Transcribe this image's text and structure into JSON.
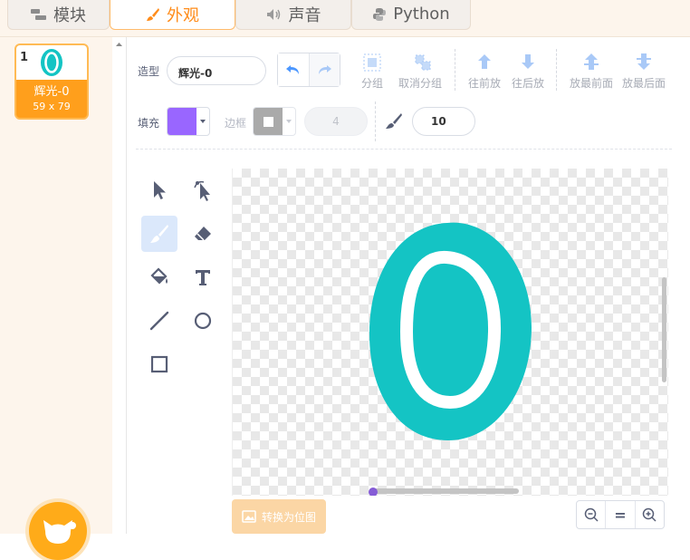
{
  "tabs": [
    {
      "label": "模块",
      "icon": "blocks-icon"
    },
    {
      "label": "外观",
      "icon": "brush-icon",
      "active": true
    },
    {
      "label": "声音",
      "icon": "speaker-icon"
    },
    {
      "label": "Python",
      "icon": "python-icon"
    }
  ],
  "sidebar": {
    "costume": {
      "number": "1",
      "name": "辉光-0",
      "size": "59 x 79"
    }
  },
  "toolbar": {
    "costume_label": "造型",
    "costume_name": "辉光-0",
    "group_label": "分组",
    "ungroup_label": "取消分组",
    "forward_label": "往前放",
    "backward_label": "往后放",
    "front_label": "放最前面",
    "back_label": "放最后面",
    "fill_label": "填充",
    "fill_color": "#9966ff",
    "outline_label": "边框",
    "outline_width": "4",
    "brush_size": "10"
  },
  "bottom": {
    "convert_label": "转换为位图",
    "zoom_equal": "="
  },
  "colors": {
    "accent": "#ff8c1a",
    "glyph": "#14c4c4",
    "selected_tool": "#dbe8fb"
  }
}
